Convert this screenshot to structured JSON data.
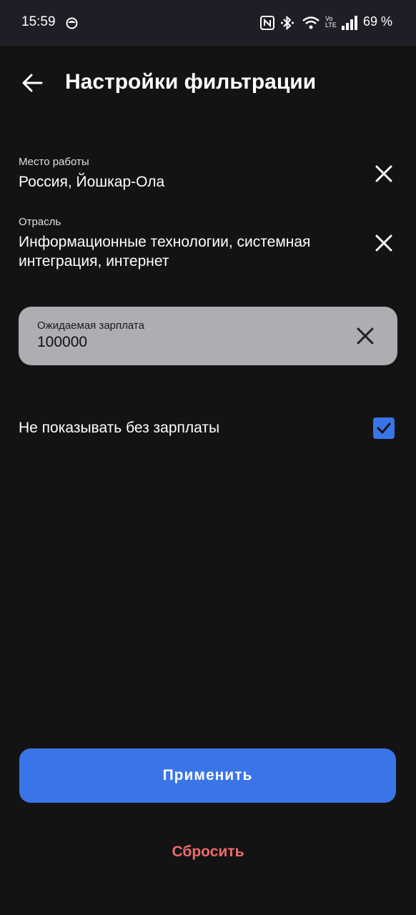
{
  "status_bar": {
    "time": "15:59",
    "battery": "69 %",
    "icons": [
      "face-icon",
      "nfc-icon",
      "bluetooth-icon",
      "wifi-icon",
      "volte-icon",
      "signal-icon"
    ]
  },
  "header": {
    "title": "Настройки фильтрации",
    "back_icon": "arrow-left-icon"
  },
  "filters": {
    "workplace": {
      "label": "Место работы",
      "value": "Россия, Йошкар-Ола"
    },
    "industry": {
      "label": "Отрасль",
      "value_line1": "Информационные технологии, системная",
      "value_line2": "интеграция, интернет"
    },
    "salary": {
      "label": "Ожидаемая зарплата",
      "value": "100000"
    },
    "hide_without_salary": {
      "label": "Не показывать без зарплаты",
      "checked": true
    }
  },
  "actions": {
    "apply_label": "Применить",
    "reset_label": "Сбросить"
  },
  "colors": {
    "background": "#131313",
    "status_bar": "#1e1f26",
    "accent": "#3a75e8",
    "reset": "#ef6b6b",
    "salary_box": "#aeaeb2"
  }
}
